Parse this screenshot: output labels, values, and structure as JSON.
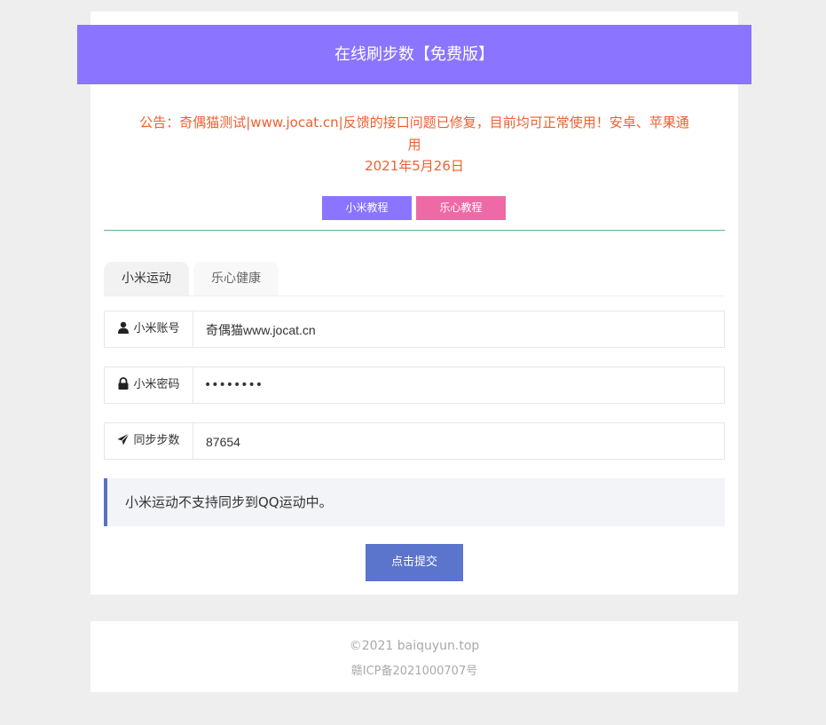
{
  "header": {
    "title": "在线刷步数【免费版】"
  },
  "notice": {
    "line1": "公告：奇偶猫测试|www.jocat.cn|反馈的接口问题已修复，目前均可正常使用！安卓、苹果通",
    "line2": "用",
    "date": "2021年5月26日"
  },
  "tutorials": {
    "xiaomi_label": "小米教程",
    "lexin_label": "乐心教程"
  },
  "tabs": [
    {
      "label": "小米运动",
      "active": true
    },
    {
      "label": "乐心健康",
      "active": false
    }
  ],
  "form": {
    "account": {
      "label": "小米账号",
      "icon": "user-icon",
      "value": "奇偶猫www.jocat.cn"
    },
    "password": {
      "label": "小米密码",
      "icon": "lock-icon",
      "value": "••••••••"
    },
    "steps": {
      "label": "同步步数",
      "icon": "send-icon",
      "value": "87654"
    }
  },
  "tip": {
    "text": "小米运动不支持同步到QQ运动中。"
  },
  "submit": {
    "label": "点击提交"
  },
  "footer": {
    "copyright": "©2021 baiquyun.top",
    "icp": "赣ICP备2021000707号"
  },
  "colors": {
    "accent_purple": "#8b74ff",
    "accent_pink": "#ee6aa6",
    "notice_orange": "#ef5f2f",
    "divider_green": "#5fb878",
    "submit_blue": "#5b74cc"
  }
}
